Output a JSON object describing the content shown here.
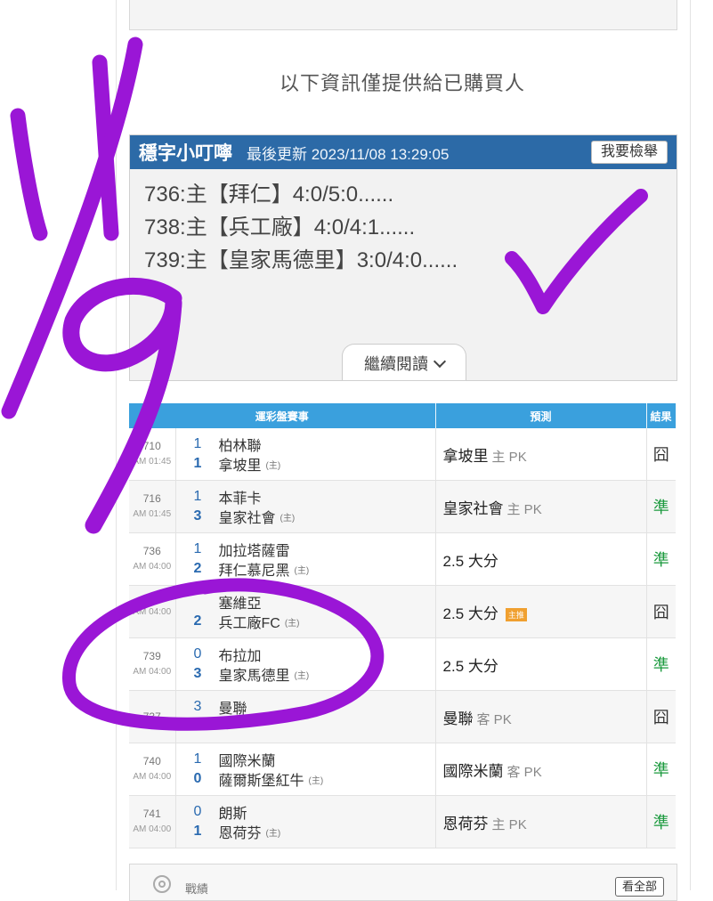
{
  "notice": "以下資訊僅提供給已購買人",
  "message_panel": {
    "title": "穩字小叮嚀",
    "updated": "最後更新 2023/11/08 13:29:05",
    "report_label": "我要檢舉",
    "lines": [
      "736:主【拜仁】4:0/5:0......",
      "738:主【兵工廠】4:0/4:1......",
      "739:主【皇家馬德里】3:0/4:0......"
    ],
    "read_more": "繼續閱讀"
  },
  "table": {
    "headers": [
      "運彩盤賽事",
      "預測",
      "結果"
    ],
    "rows": [
      {
        "id": "710",
        "time": "AM 01:45",
        "away_score": "1",
        "away": "柏林聯",
        "home_score": "1",
        "home": "拿坡里",
        "home_tag": "(主)",
        "pred": "拿坡里",
        "pred_sub": "主 PK",
        "badge": "",
        "result": "囧"
      },
      {
        "id": "716",
        "time": "AM 01:45",
        "away_score": "1",
        "away": "本菲卡",
        "home_score": "3",
        "home": "皇家社會",
        "home_tag": "(主)",
        "pred": "皇家社會",
        "pred_sub": "主 PK",
        "badge": "",
        "result": "準"
      },
      {
        "id": "736",
        "time": "AM 04:00",
        "away_score": "1",
        "away": "加拉塔薩雷",
        "home_score": "2",
        "home": "拜仁慕尼黑",
        "home_tag": "(主)",
        "pred": "2.5 大分",
        "pred_sub": "",
        "badge": "",
        "result": "準"
      },
      {
        "id": "",
        "time": "AM 04:00",
        "away_score": "",
        "away": "塞維亞",
        "home_score": "2",
        "home": "兵工廠FC",
        "home_tag": "(主)",
        "pred": "2.5 大分",
        "pred_sub": "",
        "badge": "主推",
        "result": "囧"
      },
      {
        "id": "739",
        "time": "AM 04:00",
        "away_score": "0",
        "away": "布拉加",
        "home_score": "3",
        "home": "皇家馬德里",
        "home_tag": "(主)",
        "pred": "2.5 大分",
        "pred_sub": "",
        "badge": "",
        "result": "準"
      },
      {
        "id": "737",
        "time": "",
        "away_score": "3",
        "away": "曼聯",
        "home_score": "",
        "home": "",
        "home_tag": "",
        "pred": "曼聯",
        "pred_sub": "客 PK",
        "badge": "",
        "result": "囧"
      },
      {
        "id": "740",
        "time": "AM 04:00",
        "away_score": "1",
        "away": "國際米蘭",
        "home_score": "0",
        "home": "薩爾斯堡紅牛",
        "home_tag": "(主)",
        "pred": "國際米蘭",
        "pred_sub": "客 PK",
        "badge": "",
        "result": "準"
      },
      {
        "id": "741",
        "time": "AM 04:00",
        "away_score": "0",
        "away": "朗斯",
        "home_score": "1",
        "home": "恩荷芬",
        "home_tag": "(主)",
        "pred": "恩荷芬",
        "pred_sub": "主 PK",
        "badge": "",
        "result": "準"
      }
    ]
  },
  "footer": {
    "record_label": "戰績",
    "see_all": "看全部"
  },
  "colors": {
    "header_blue": "#2c6aa7",
    "table_header": "#3aa0dd",
    "hit_green": "#1b9a3e",
    "marker_purple": "#9a16d6"
  },
  "icons": [
    "chevron-down-icon",
    "record-icon",
    "handwritten-annotation"
  ]
}
